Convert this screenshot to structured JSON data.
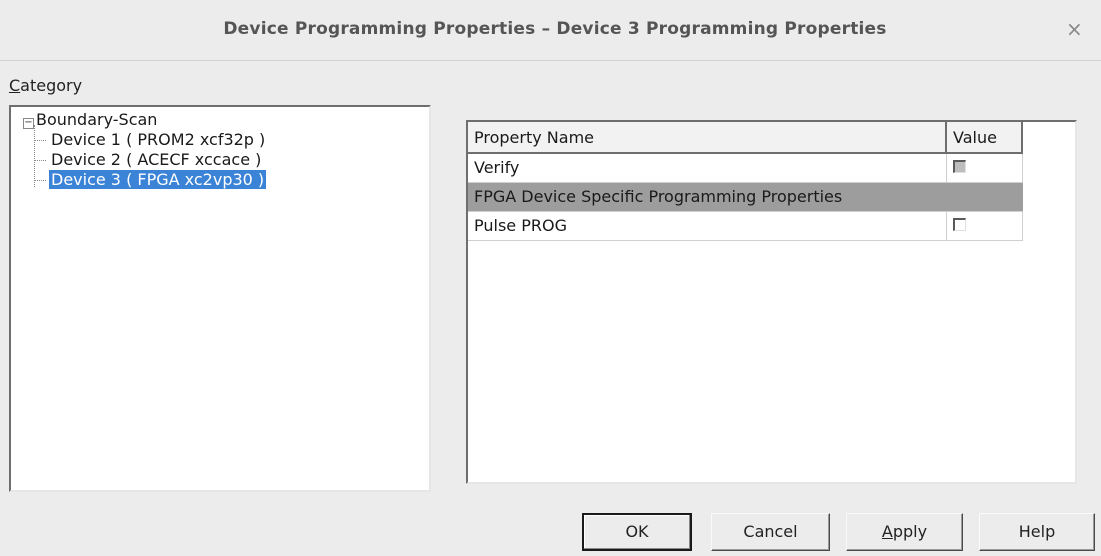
{
  "window": {
    "title": "Device Programming Properties – Device 3 Programming Properties",
    "close_glyph": "×"
  },
  "category": {
    "label_first": "C",
    "label_rest": "ategory"
  },
  "tree": {
    "expander_glyph": "−",
    "root": "Boundary-Scan",
    "items": [
      {
        "label": "Device 1 ( PROM2 xcf32p )",
        "selected": false
      },
      {
        "label": "Device 2 ( ACECF xccace )",
        "selected": false
      },
      {
        "label": "Device 3 ( FPGA xc2vp30 )",
        "selected": true
      }
    ]
  },
  "grid": {
    "columns": [
      "Property Name",
      "Value"
    ],
    "rows": [
      {
        "name": "Verify",
        "type": "checkbox",
        "checked": false,
        "disabled": true
      },
      {
        "name": "FPGA Device Specific Programming Properties",
        "type": "group"
      },
      {
        "name": "Pulse PROG",
        "type": "checkbox",
        "checked": false,
        "disabled": false
      }
    ]
  },
  "buttons": {
    "ok": "OK",
    "cancel": "Cancel",
    "apply_first": "A",
    "apply_rest": "pply",
    "help": "Help"
  },
  "colors": {
    "selection": "#3b83d6",
    "group_row": "#9d9d9d"
  }
}
